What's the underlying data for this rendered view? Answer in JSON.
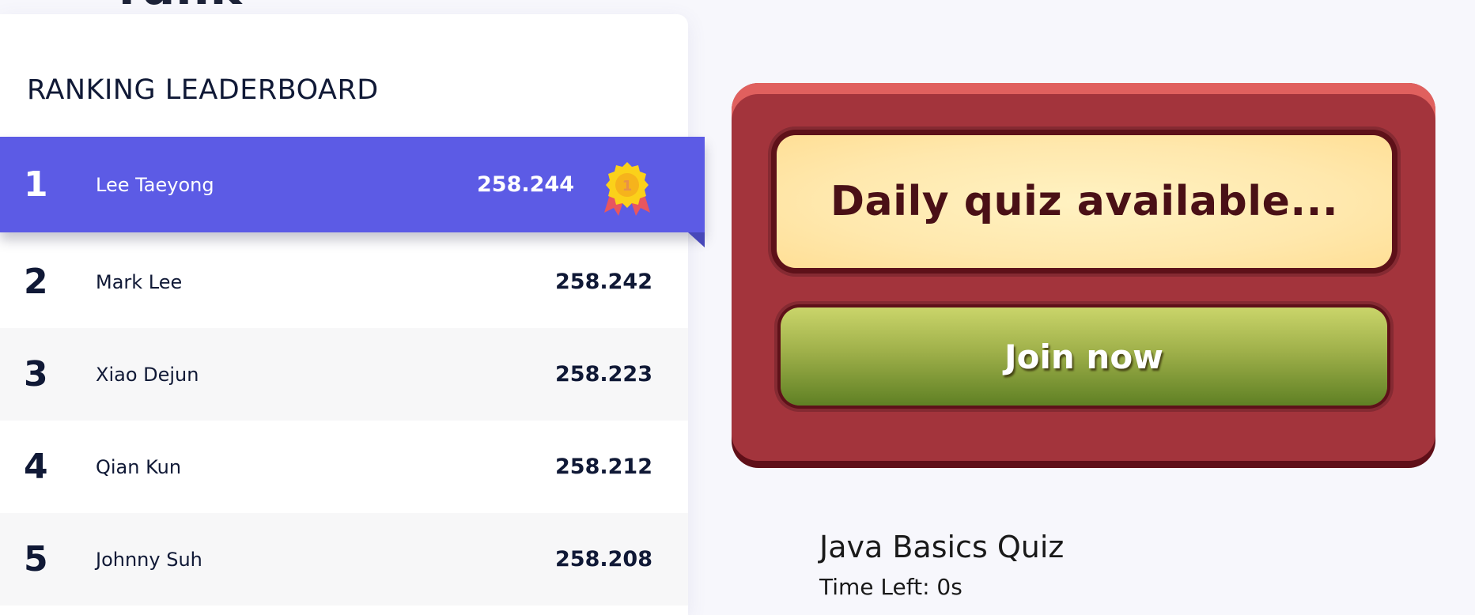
{
  "page": {
    "heading_fragment": "rank"
  },
  "leaderboard": {
    "title": "RANKING LEADERBOARD",
    "rows": [
      {
        "rank": "1",
        "name": "Lee Taeyong",
        "score": "258.244",
        "badge": "medal-icon"
      },
      {
        "rank": "2",
        "name": "Mark Lee",
        "score": "258.242"
      },
      {
        "rank": "3",
        "name": "Xiao Dejun",
        "score": "258.223"
      },
      {
        "rank": "4",
        "name": "Qian Kun",
        "score": "258.212"
      },
      {
        "rank": "5",
        "name": "Johnny Suh",
        "score": "258.208"
      }
    ],
    "medal_digit": "1"
  },
  "quiz": {
    "banner_text": "Daily quiz available...",
    "join_label": "Join now",
    "name": "Java Basics Quiz",
    "time_left": "Time Left: 0s"
  },
  "colors": {
    "page_bg": "#f7f7fc",
    "leader_highlight": "#5c5be5",
    "card_red": "#a3343c",
    "banner_cream": "#ffe8ad",
    "join_green": "#9fb04a",
    "text_dark": "#101936"
  }
}
